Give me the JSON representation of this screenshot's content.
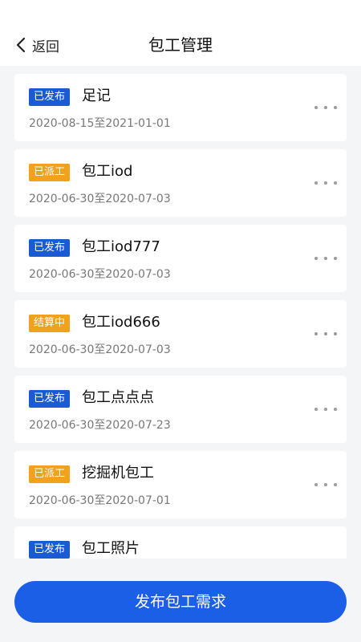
{
  "header": {
    "back_label": "返回",
    "title": "包工管理",
    "back_icon": "chevron-left-icon"
  },
  "projects": [
    {
      "status": "已发布",
      "status_color": "#1a5ad2",
      "name": "足记",
      "dates": "2020-08-15至2021-01-01"
    },
    {
      "status": "已派工",
      "status_color": "#f0a21d",
      "name": "包工iod",
      "dates": "2020-06-30至2020-07-03"
    },
    {
      "status": "已发布",
      "status_color": "#1a5ad2",
      "name": "包工iod777",
      "dates": "2020-06-30至2020-07-03"
    },
    {
      "status": "结算中",
      "status_color": "#f0a21d",
      "name": "包工iod666",
      "dates": "2020-06-30至2020-07-03"
    },
    {
      "status": "已发布",
      "status_color": "#1a5ad2",
      "name": "包工点点点",
      "dates": "2020-06-30至2020-07-23"
    },
    {
      "status": "已派工",
      "status_color": "#f0a21d",
      "name": "挖掘机包工",
      "dates": "2020-06-30至2020-07-01"
    },
    {
      "status": "已发布",
      "status_color": "#1a5ad2",
      "name": "包工照片",
      "dates": ""
    }
  ],
  "more_icon": "more-horizontal-icon",
  "footer": {
    "publish_label": "发布包工需求",
    "button_color": "#1a5fe6"
  }
}
